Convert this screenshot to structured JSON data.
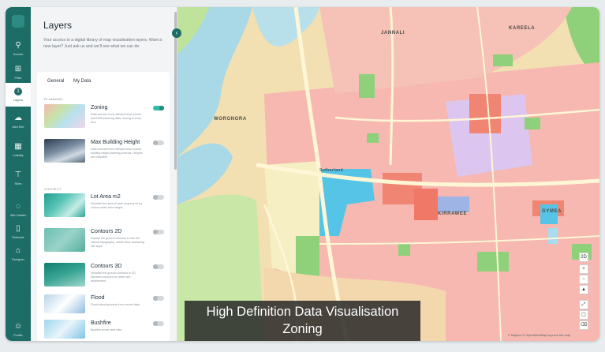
{
  "rail": {
    "items": [
      {
        "label": "Search",
        "icon": "search-icon"
      },
      {
        "label": "Filter",
        "icon": "filter-icon"
      },
      {
        "label": "Layers",
        "icon": "layers-icon",
        "badge": "1"
      },
      {
        "label": "Add Site",
        "icon": "add-site-icon"
      },
      {
        "label": "Liability",
        "icon": "analytics-icon"
      },
      {
        "label": "Sites",
        "icon": "sites-icon"
      },
      {
        "label": "Site Details",
        "icon": "info-icon"
      },
      {
        "label": "Estimate",
        "icon": "estimate-icon"
      },
      {
        "label": "Designer",
        "icon": "designer-icon"
      },
      {
        "label": "Profile",
        "icon": "profile-icon"
      }
    ]
  },
  "panel": {
    "title": "Layers",
    "description": "Your access to a digital library of map visualisation layers. Want a new layer? Just ask us and we'll see what we can do.",
    "tabs": [
      "General",
      "My Data"
    ],
    "sections": {
      "planning": "PLANNING",
      "context": "CONTEXT"
    },
    "layers": [
      {
        "name": "Zoning",
        "desc": "Data sourced from relevant local council and NSW planning data. Zoning is a key item",
        "on": true
      },
      {
        "name": "Max Building Height",
        "desc": "Data sourced from relevant local council building height planning controls. Heights are indicative",
        "on": false
      },
      {
        "name": "Lot Area m2",
        "desc": "Visualise the area of each property lot by colour-coded area ranges",
        "on": false
      },
      {
        "name": "Contours 2D",
        "desc": "Explore the ground contours to see the natural topography, useful when assessing site slope",
        "on": false
      },
      {
        "name": "Contours 3D",
        "desc": "Visualise the ground contours in 3D, elevated contours for better site assessment",
        "on": false
      },
      {
        "name": "Flood",
        "desc": "Flood planning areas from council data",
        "on": false
      },
      {
        "name": "Bushfire",
        "desc": "Bushfire prone land data",
        "on": false
      }
    ]
  },
  "map": {
    "labels": [
      "JANNALI",
      "KAREELA",
      "WORONORA",
      "Sutherland",
      "KIRRAWEE",
      "GYMEA"
    ],
    "controls": [
      "2D",
      "+",
      "−",
      "▲",
      "⤢",
      "▢",
      "⌫"
    ],
    "attribution": "© Mapbox © OpenStreetMap Improve this map"
  },
  "caption": {
    "line1": "High Definition Data Visualisation",
    "line2": "Zoning"
  },
  "colors": {
    "rail": "#1e6c66",
    "accent": "#35b9a8",
    "residential": "#f6b8b0",
    "commercial": "#56c4e6",
    "industrial": "#dcc6f0",
    "park": "#8fd17a",
    "water": "#a8d8e8"
  }
}
